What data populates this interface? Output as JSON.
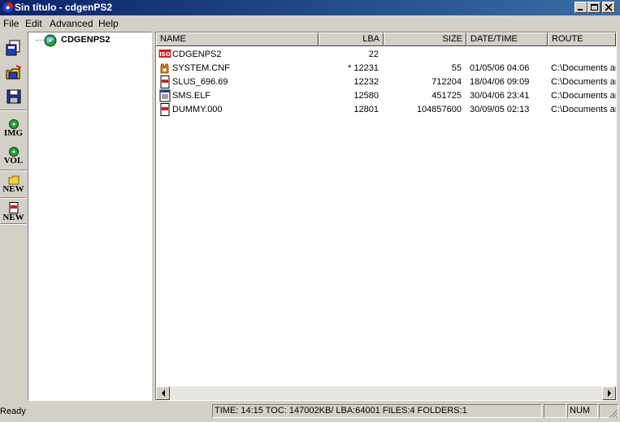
{
  "window": {
    "title": "Sin título - cdgenPS2"
  },
  "menu": [
    "File",
    "Edit",
    "Advanced",
    "Help"
  ],
  "toolbar": {
    "img_label": "IMG",
    "vol_label": "VOL",
    "new_folder_label": "NEW",
    "new_file_label": "NEW"
  },
  "tree": {
    "root": "CDGENPS2"
  },
  "list": {
    "columns": [
      "NAME",
      "LBA",
      "SIZE",
      "DATE/TIME",
      "ROUTE"
    ],
    "rows": [
      {
        "icon": "iso-icon",
        "name": "CDGENPS2",
        "lba": "22",
        "size": "",
        "date": "",
        "route": ""
      },
      {
        "icon": "cnf-icon",
        "name": "SYSTEM.CNF",
        "lba": "* 12231",
        "size": "55",
        "date": "01/05/06 04:06",
        "route": "C:\\Documents and"
      },
      {
        "icon": "file-icon",
        "name": "SLUS_696.69",
        "lba": "12232",
        "size": "712204",
        "date": "18/04/06 09:09",
        "route": "C:\\Documents and"
      },
      {
        "icon": "elf-icon",
        "name": "SMS.ELF",
        "lba": "12580",
        "size": "451725",
        "date": "30/04/06 23:41",
        "route": "C:\\Documents and"
      },
      {
        "icon": "file-icon",
        "name": "DUMMY.000",
        "lba": "12801",
        "size": "104857600",
        "date": "30/09/05 02:13",
        "route": "C:\\Documents and"
      }
    ]
  },
  "status": {
    "ready": "Ready",
    "info": "TIME: 14:15   TOC: 147002KB/ LBA:64001  FILES:4 FOLDERS:1",
    "num": "NUM"
  },
  "colors": {
    "title_start": "#0a246a",
    "title_end": "#3a6ea5",
    "face": "#d4d0c8"
  }
}
